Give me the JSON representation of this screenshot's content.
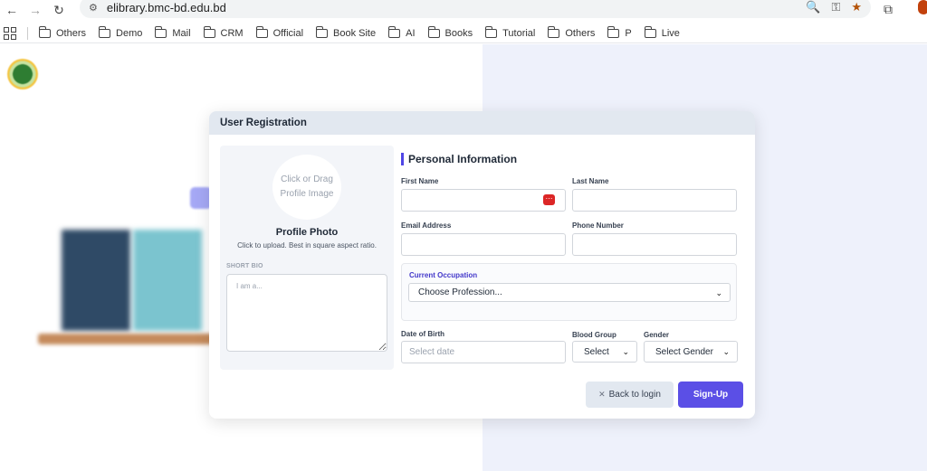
{
  "browser": {
    "url": "elibrary.bmc-bd.edu.bd",
    "bookmarks": [
      "Others",
      "Demo",
      "Mail",
      "CRM",
      "Official",
      "Book Site",
      "AI",
      "Books",
      "Tutorial",
      "Others",
      "P",
      "Live"
    ]
  },
  "modal": {
    "title": "User Registration",
    "profile": {
      "drop_text_1": "Click or Drag",
      "drop_text_2": "Profile Image",
      "title": "Profile Photo",
      "hint": "Click to upload. Best in square aspect ratio.",
      "bio_label": "SHORT BIO",
      "bio_placeholder": "I am a..."
    },
    "personal": {
      "section_title": "Personal Information",
      "first_name_label": "First Name",
      "first_name_value": "",
      "last_name_label": "Last Name",
      "last_name_value": "",
      "email_label": "Email Address",
      "email_value": "",
      "phone_label": "Phone Number",
      "phone_value": "",
      "occupation_label": "Current Occupation",
      "occupation_selected": "Choose Profession...",
      "dob_label": "Date of Birth",
      "dob_placeholder": "Select date",
      "blood_group_label": "Blood Group",
      "blood_group_selected": "Select",
      "gender_label": "Gender",
      "gender_selected": "Select Gender"
    },
    "buttons": {
      "back": "Back to login",
      "signup": "Sign-Up"
    }
  },
  "colors": {
    "accent": "#5b4fe6",
    "occupation_label": "#4338ca",
    "header_bg": "#e2e8f0"
  }
}
